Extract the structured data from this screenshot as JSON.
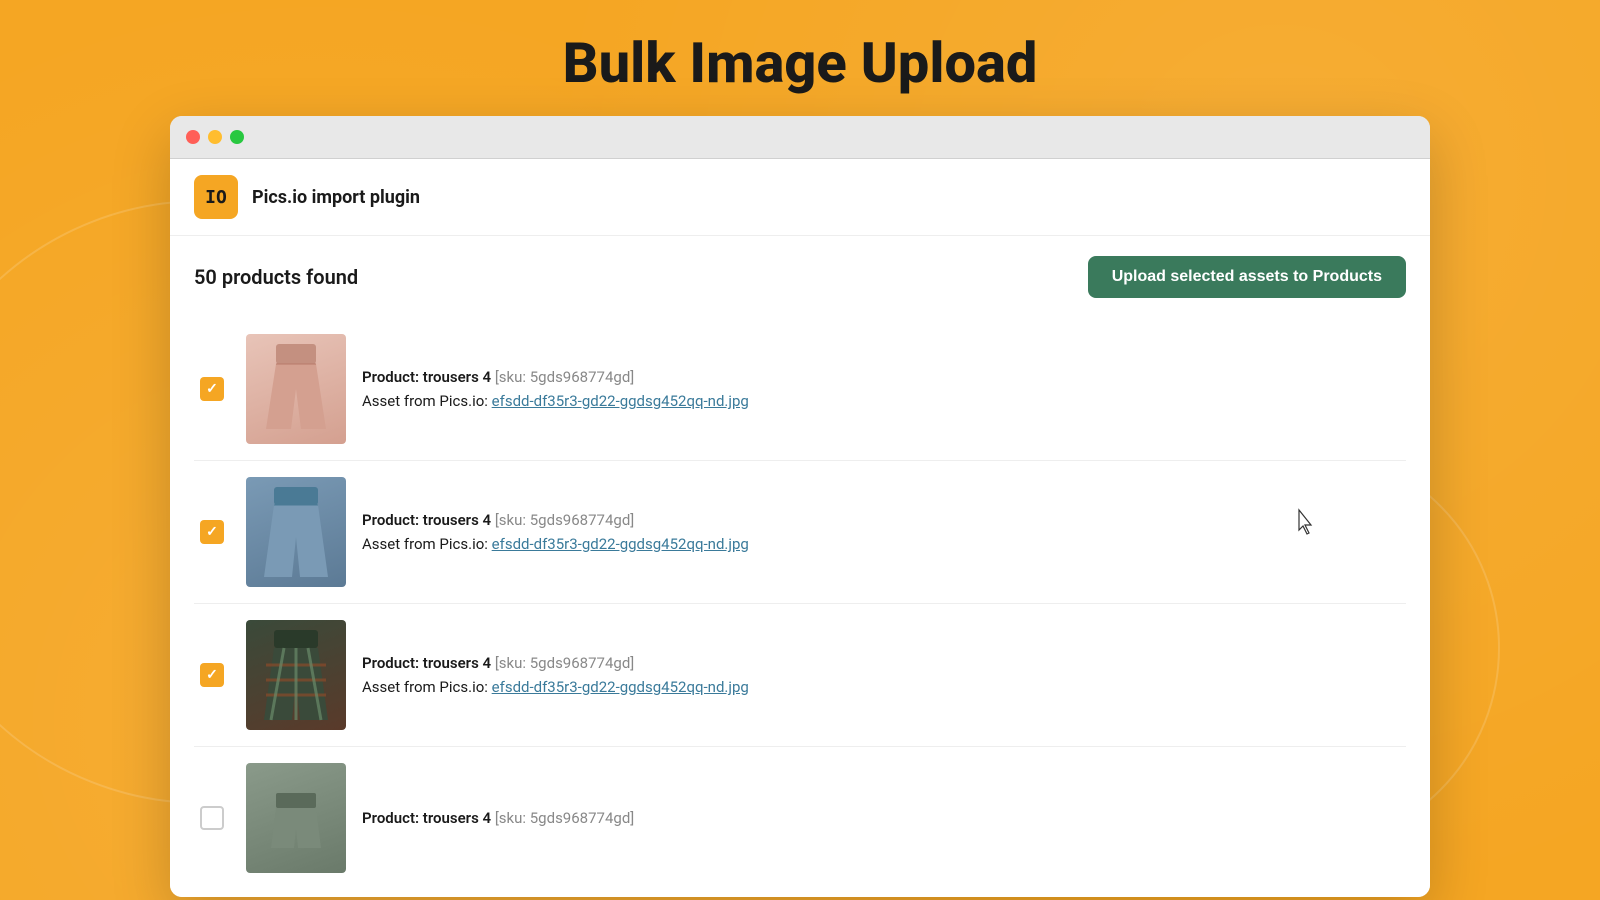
{
  "page": {
    "title": "Bulk Image Upload",
    "background_color": "#F5A623"
  },
  "window": {
    "buttons": {
      "close": "close",
      "minimize": "minimize",
      "maximize": "maximize"
    }
  },
  "app": {
    "logo_text": "IO",
    "name": "Pics.io import plugin"
  },
  "products": {
    "count_label": "50 products found",
    "upload_button_label": "Upload selected assets to Products",
    "items": [
      {
        "id": 1,
        "checked": true,
        "product_label": "Product:",
        "product_name": "trousers 4",
        "sku_label": "[sku: 5gds968774gd]",
        "asset_label": "Asset from Pics.io:",
        "asset_link": "efsdd-df35r3-gd22-ggdsg452qq-nd.jpg",
        "thumb_class": "pants-pink"
      },
      {
        "id": 2,
        "checked": true,
        "product_label": "Product:",
        "product_name": "trousers 4",
        "sku_label": "[sku: 5gds968774gd]",
        "asset_label": "Asset from Pics.io:",
        "asset_link": "efsdd-df35r3-gd22-ggdsg452qq-nd.jpg",
        "thumb_class": "pants-blue"
      },
      {
        "id": 3,
        "checked": true,
        "product_label": "Product:",
        "product_name": "trousers 4",
        "sku_label": "[sku: 5gds968774gd]",
        "asset_label": "Asset from Pics.io:",
        "asset_link": "efsdd-df35r3-gd22-ggdsg452qq-nd.jpg",
        "thumb_class": "pants-plaid"
      },
      {
        "id": 4,
        "checked": false,
        "product_label": "Product:",
        "product_name": "trousers 4",
        "sku_label": "[sku: 5gds968774gd]",
        "asset_label": "",
        "asset_link": "",
        "thumb_class": "pants-partial"
      }
    ]
  }
}
